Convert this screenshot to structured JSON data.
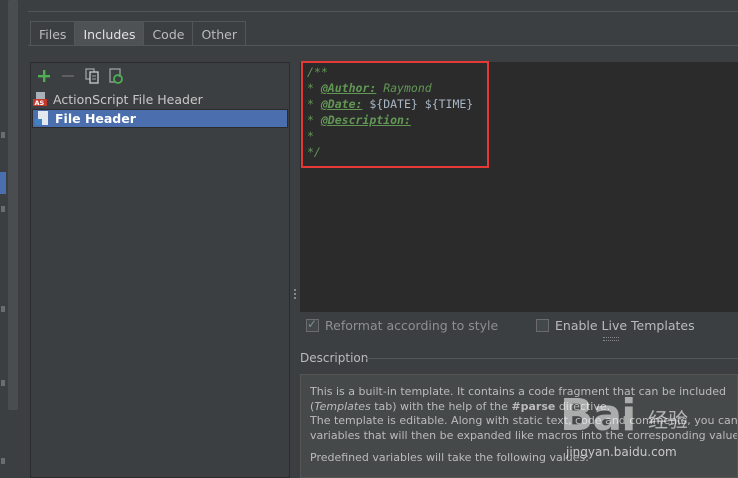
{
  "tabs": [
    {
      "label": "Files",
      "active": false
    },
    {
      "label": "Includes",
      "active": true
    },
    {
      "label": "Code",
      "active": false
    },
    {
      "label": "Other",
      "active": false
    }
  ],
  "toolbar": {
    "icons": [
      "add-icon",
      "remove-icon",
      "copy-icon",
      "reset-icon"
    ],
    "colors": {
      "add": "#4caf50",
      "remove": "#6e6e6e"
    }
  },
  "templates": [
    {
      "label": "ActionScript File Header",
      "icon": "actionscript-file-icon",
      "icon_badge": "AS",
      "selected": false
    },
    {
      "label": "File Header",
      "icon": "file-icon",
      "selected": true
    }
  ],
  "editor": {
    "open": "/**",
    "star": "*",
    "author_tag": "@Author:",
    "author_value": "Raymond",
    "date_tag": "@Date:",
    "date_v1": "${DATE}",
    "date_v2": "${TIME}",
    "desc_tag": "@Description:",
    "close": "*/"
  },
  "options": {
    "reformat": {
      "label": "Reformat according to style",
      "checked": true,
      "enabled": false
    },
    "live_templates": {
      "label": "Enable Live Templates",
      "checked": false
    }
  },
  "description": {
    "heading": "Description",
    "line1": "This is a built-in template. It contains a code fragment that can be included",
    "line2_a": "(",
    "line2_em": "Templates",
    "line2_b": " tab) with the help of the ",
    "line2_code": "#parse",
    "line2_c": " directive.",
    "line3": "The template is editable. Along with static text, code and comments, you can",
    "line4": "variables that will then be expanded like macros into the corresponding values",
    "line5": "Predefined variables will take the following values:"
  },
  "watermark": {
    "logo": "Bai",
    "cn": "经验",
    "url": "jingyan.baidu.com"
  }
}
